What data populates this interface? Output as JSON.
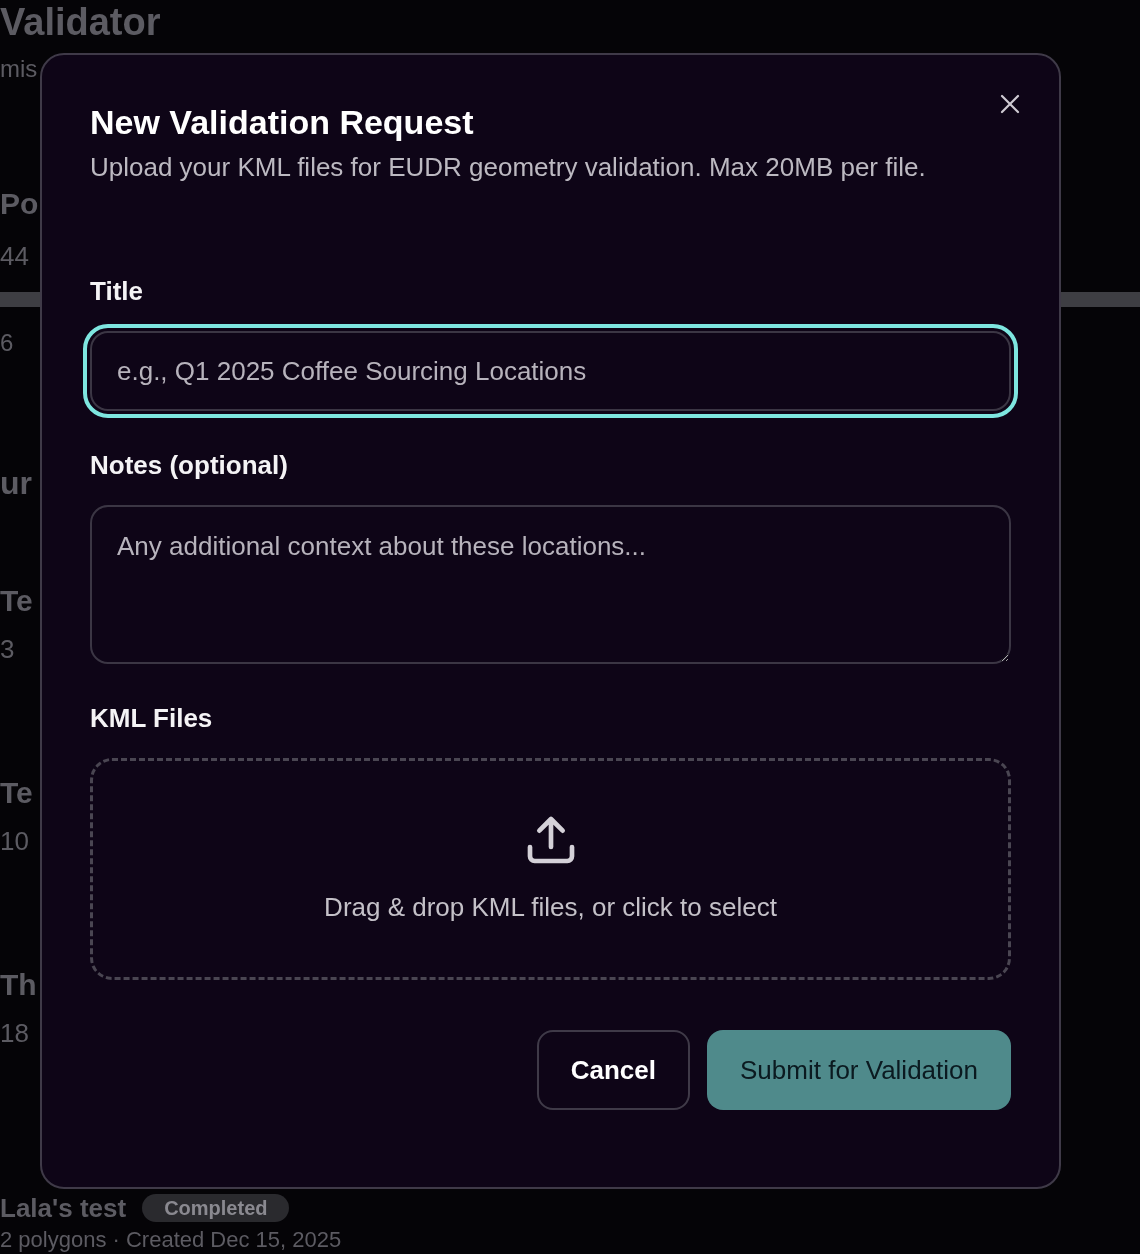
{
  "background": {
    "title": "Validator",
    "subtitle": "mis",
    "stat_label": "Po",
    "stat_value": "44",
    "progress": {
      "level": 1
    },
    "stat_caption": "6",
    "section_title": "ur",
    "rows": [
      {
        "name": "Te",
        "meta": "3"
      },
      {
        "name": "Te",
        "meta": "10"
      },
      {
        "name": "Th",
        "meta": "18"
      }
    ],
    "last_row": {
      "name": "Lala's test",
      "badge": "Completed",
      "meta": "2 polygons · Created Dec 15, 2025"
    }
  },
  "dialog": {
    "title": "New Validation Request",
    "description": "Upload your KML files for EUDR geometry validation. Max 20MB per file.",
    "fields": [
      {
        "kind": "input",
        "label": "Title",
        "placeholder": "e.g., Q1 2025 Coffee Sourcing Locations",
        "focused": true
      },
      {
        "kind": "textarea",
        "label": "Notes (optional)",
        "placeholder": "Any additional context about these locations...",
        "focused": false
      },
      {
        "kind": "dropzone",
        "label": "KML Files",
        "placeholder": "Drag & drop KML files, or click to select",
        "focused": false
      }
    ],
    "buttons": [
      {
        "label": "Cancel",
        "kind": "secondary"
      },
      {
        "label": "Submit for Validation",
        "kind": "primary"
      }
    ]
  }
}
